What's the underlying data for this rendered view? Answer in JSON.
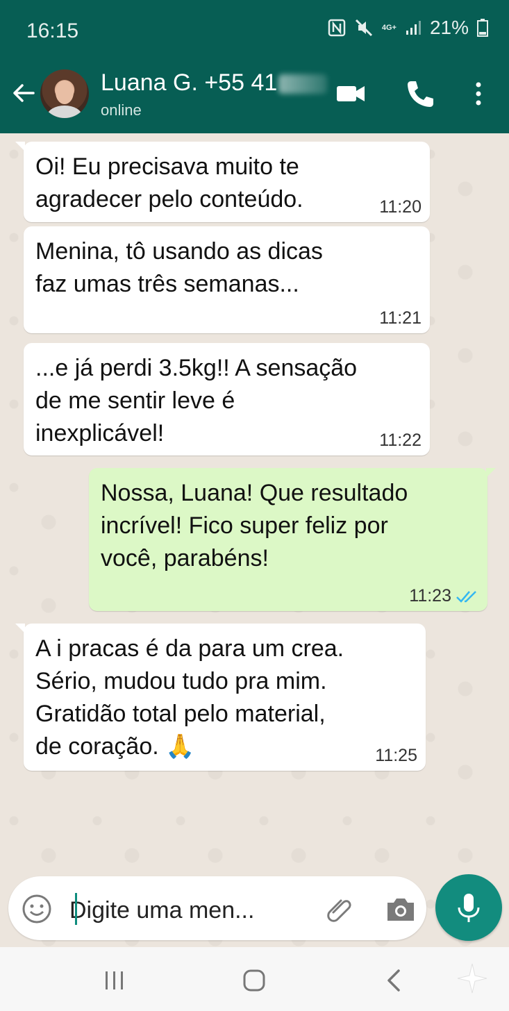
{
  "status_bar": {
    "time": "16:15",
    "network": "4G+",
    "battery": "21%",
    "icons": [
      "nfc-icon",
      "mute-icon",
      "signal-icon",
      "battery-icon"
    ]
  },
  "header": {
    "contact_name": "Luana G. +55 41",
    "status": "online",
    "icons": [
      "back-arrow-icon",
      "video-call-icon",
      "phone-icon",
      "more-options-icon"
    ]
  },
  "messages": [
    {
      "direction": "in",
      "text": "Oi! Eu precisava muito te\nagradecer pelo conteúdo.",
      "time": "11:20"
    },
    {
      "direction": "in",
      "text": "Menina, tô usando as dicas\nfaz umas três semanas...",
      "time": "11:21"
    },
    {
      "direction": "in",
      "text": "...e já perdi 3.5kg!! A sensação\nde me sentir leve é\ninexplicável!",
      "time": "11:22"
    },
    {
      "direction": "out",
      "text": "Nossa, Luana! Que resultado\nincrível! Fico super feliz por\nvocê, parabéns!",
      "time": "11:23",
      "read": true
    },
    {
      "direction": "in",
      "text": "A i pracas é da para um crea.\nSério, mudou tudo pra mim.\nGratidão total pelo material,\nde coração. 🙏",
      "time": "11:25"
    }
  ],
  "composer": {
    "placeholder": "Digite uma men...",
    "icons": [
      "emoji-icon",
      "attach-icon",
      "camera-icon",
      "microphone-icon"
    ]
  },
  "colors": {
    "header": "#075e54",
    "outgoing_bubble": "#dcf8c6",
    "incoming_bubble": "#ffffff",
    "chat_background": "#ece5dd",
    "mic_button": "#128c7e",
    "read_ticks": "#34b7f1"
  }
}
